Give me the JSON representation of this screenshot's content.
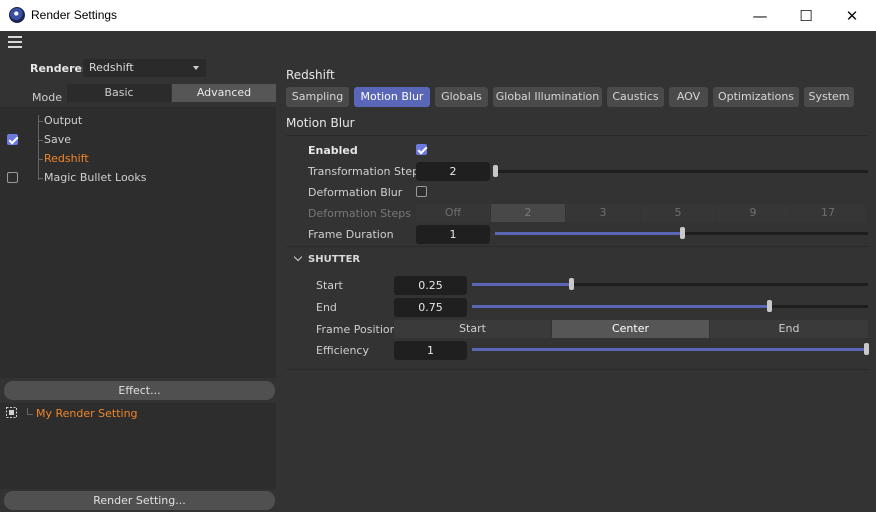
{
  "window": {
    "title": "Render Settings",
    "minimize": "—",
    "maximize": "☐",
    "close": "✕"
  },
  "left": {
    "renderer_label": "Renderer",
    "renderer_value": "Redshift",
    "mode_label": "Mode",
    "mode_options": [
      "Basic",
      "Advanced"
    ],
    "mode_selected": "Advanced",
    "tree": [
      {
        "label": "Output",
        "checked": null
      },
      {
        "label": "Save",
        "checked": true
      },
      {
        "label": "Redshift",
        "checked": null,
        "active": true
      },
      {
        "label": "Magic Bullet Looks",
        "checked": false
      }
    ],
    "effect_button": "Effect...",
    "render_setting_item": "My Render Setting",
    "render_setting_button": "Render Setting..."
  },
  "main": {
    "renderer_name": "Redshift",
    "tabs": [
      "Sampling",
      "Motion Blur",
      "Globals",
      "Global Illumination",
      "Caustics",
      "AOV",
      "Optimizations",
      "System"
    ],
    "active_tab": "Motion Blur",
    "section_title": "Motion Blur",
    "enabled_label": "Enabled",
    "enabled": true,
    "transformation_steps_label": "Transformation Steps",
    "transformation_steps_value": "2",
    "transformation_steps_slider": 0.0,
    "deformation_blur_label": "Deformation Blur",
    "deformation_blur": false,
    "deformation_steps_label": "Deformation Steps",
    "deformation_steps_options": [
      "Off",
      "2",
      "3",
      "5",
      "9",
      "17"
    ],
    "deformation_steps_selected": "2",
    "frame_duration_label": "Frame Duration",
    "frame_duration_value": "1",
    "frame_duration_slider": 0.5,
    "shutter": {
      "header": "SHUTTER",
      "start_label": "Start",
      "start_value": "0.25",
      "start_slider": 0.25,
      "end_label": "End",
      "end_value": "0.75",
      "end_slider": 0.75,
      "frame_position_label": "Frame Position",
      "frame_position_options": [
        "Start",
        "Center",
        "End"
      ],
      "frame_position_selected": "Center",
      "efficiency_label": "Efficiency",
      "efficiency_value": "1",
      "efficiency_slider": 1.0
    }
  },
  "colors": {
    "accent": "#5a66b8",
    "active_item": "#f0852a",
    "background": "#333333",
    "titlebar": "#ffffff"
  }
}
